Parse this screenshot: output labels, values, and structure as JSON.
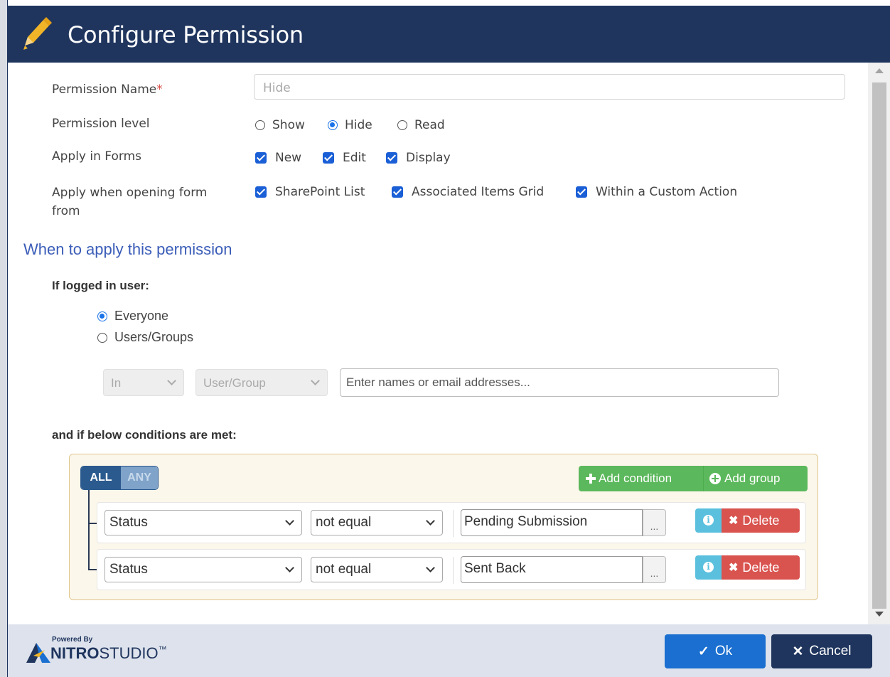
{
  "header": {
    "title": "Configure Permission"
  },
  "form": {
    "permission_name_label": "Permission Name",
    "required_mark": "*",
    "permission_name_value": "Hide",
    "permission_level_label": "Permission level",
    "permission_levels": [
      {
        "label": "Show",
        "selected": false
      },
      {
        "label": "Hide",
        "selected": true
      },
      {
        "label": "Read",
        "selected": false
      }
    ],
    "apply_forms_label": "Apply in Forms",
    "forms": [
      {
        "label": "New",
        "checked": true
      },
      {
        "label": "Edit",
        "checked": true
      },
      {
        "label": "Display",
        "checked": true
      }
    ],
    "apply_opening_label_line1": "Apply when opening form",
    "apply_opening_label_line2": "from",
    "opening_sources": [
      {
        "label": "SharePoint List",
        "checked": true
      },
      {
        "label": "Associated Items Grid",
        "checked": true
      },
      {
        "label": "Within a Custom Action",
        "checked": true
      }
    ]
  },
  "when": {
    "section_title": "When to apply this permission",
    "logged_in_label": "If logged in user:",
    "user_options": [
      {
        "label": "Everyone",
        "selected": true
      },
      {
        "label": "Users/Groups",
        "selected": false
      }
    ],
    "in_select": "In",
    "usergroup_select": "User/Group",
    "names_placeholder": "Enter names or email addresses...",
    "conditions_label": "and if below conditions are met:"
  },
  "conditions": {
    "all_label": "ALL",
    "any_label": "ANY",
    "add_condition_label": "Add condition",
    "add_group_label": "Add group",
    "rules": [
      {
        "field": "Status",
        "operator": "not equal",
        "value": "Pending Submission"
      },
      {
        "field": "Status",
        "operator": "not equal",
        "value": "Sent Back"
      }
    ],
    "dots_label": "...",
    "delete_label": "Delete"
  },
  "footer": {
    "powered_by": "Powered By",
    "brand_bold": "NITRO",
    "brand_light": "STUDIO",
    "trademark": "™",
    "ok_label": "Ok",
    "cancel_label": "Cancel"
  },
  "colors": {
    "header_bg": "#1f355e",
    "accent_blue": "#1a73e8",
    "add_green": "#5cb85c",
    "info_cyan": "#5bc0de",
    "delete_red": "#d9534f",
    "ok_blue": "#1a6fd0"
  }
}
